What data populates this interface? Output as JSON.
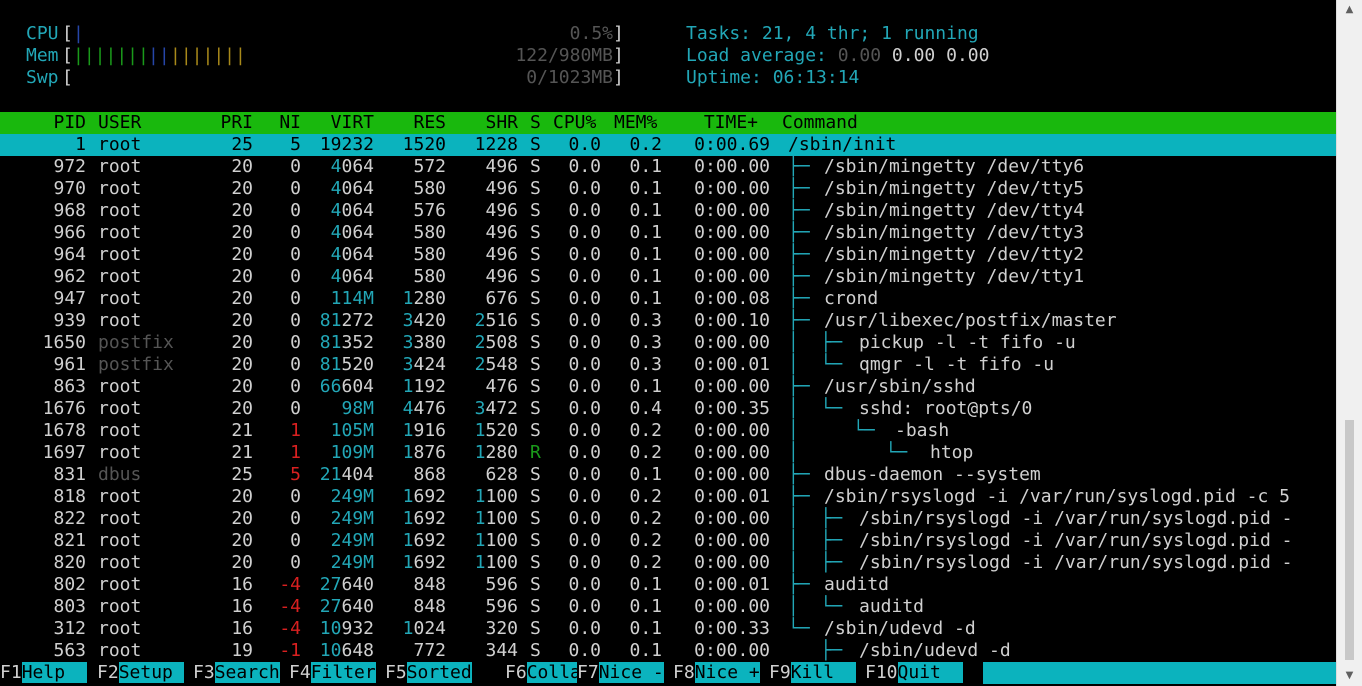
{
  "meters": {
    "cpu": {
      "label": "CPU",
      "bar": "|",
      "value": "0.5%"
    },
    "mem": {
      "label": "Mem",
      "bar_green": "|||||||",
      "bar_blue": "||",
      "bar_yellow": "|||||||",
      "value": "122/980MB"
    },
    "swp": {
      "label": "Swp",
      "value": "0/1023MB"
    }
  },
  "summary": {
    "tasks_label": "Tasks: ",
    "tasks_count": "21",
    "tasks_sep": ", ",
    "threads": "4",
    "threads_label": " thr; ",
    "running": "1",
    "running_label": " running",
    "load_label": "Load average: ",
    "load1": "0.00",
    "load5": "0.00",
    "load15": "0.00",
    "uptime_label": "Uptime: ",
    "uptime": "06:13:14"
  },
  "columns": {
    "pid": "PID",
    "user": "USER",
    "pri": "PRI",
    "ni": "NI",
    "virt": "VIRT",
    "res": "RES",
    "shr": "SHR",
    "s": "S",
    "cpu": "CPU%",
    "mem": "MEM%",
    "time": "TIME+",
    "cmd": "Command"
  },
  "processes": [
    {
      "pid": "1",
      "user": "root",
      "pri": "25",
      "ni": "5",
      "virt": "19232",
      "res": "1520",
      "shr": "1228",
      "s": "S",
      "cpu": "0.0",
      "mem": "0.2",
      "time": "0:00.69",
      "tree": "",
      "cmd": "/sbin/init"
    },
    {
      "pid": "972",
      "user": "root",
      "pri": "20",
      "ni": "0",
      "virt": "4064",
      "res": "572",
      "shr": "496",
      "s": "S",
      "cpu": "0.0",
      "mem": "0.1",
      "time": "0:00.00",
      "tree": "├─ ",
      "cmd": "/sbin/mingetty /dev/tty6"
    },
    {
      "pid": "970",
      "user": "root",
      "pri": "20",
      "ni": "0",
      "virt": "4064",
      "res": "580",
      "shr": "496",
      "s": "S",
      "cpu": "0.0",
      "mem": "0.1",
      "time": "0:00.00",
      "tree": "├─ ",
      "cmd": "/sbin/mingetty /dev/tty5"
    },
    {
      "pid": "968",
      "user": "root",
      "pri": "20",
      "ni": "0",
      "virt": "4064",
      "res": "576",
      "shr": "496",
      "s": "S",
      "cpu": "0.0",
      "mem": "0.1",
      "time": "0:00.00",
      "tree": "├─ ",
      "cmd": "/sbin/mingetty /dev/tty4"
    },
    {
      "pid": "966",
      "user": "root",
      "pri": "20",
      "ni": "0",
      "virt": "4064",
      "res": "580",
      "shr": "496",
      "s": "S",
      "cpu": "0.0",
      "mem": "0.1",
      "time": "0:00.00",
      "tree": "├─ ",
      "cmd": "/sbin/mingetty /dev/tty3"
    },
    {
      "pid": "964",
      "user": "root",
      "pri": "20",
      "ni": "0",
      "virt": "4064",
      "res": "580",
      "shr": "496",
      "s": "S",
      "cpu": "0.0",
      "mem": "0.1",
      "time": "0:00.00",
      "tree": "├─ ",
      "cmd": "/sbin/mingetty /dev/tty2"
    },
    {
      "pid": "962",
      "user": "root",
      "pri": "20",
      "ni": "0",
      "virt": "4064",
      "res": "580",
      "shr": "496",
      "s": "S",
      "cpu": "0.0",
      "mem": "0.1",
      "time": "0:00.00",
      "tree": "├─ ",
      "cmd": "/sbin/mingetty /dev/tty1"
    },
    {
      "pid": "947",
      "user": "root",
      "pri": "20",
      "ni": "0",
      "virt": "114M",
      "res": "1280",
      "shr": "676",
      "s": "S",
      "cpu": "0.0",
      "mem": "0.1",
      "time": "0:00.08",
      "tree": "├─ ",
      "cmd": "crond"
    },
    {
      "pid": "939",
      "user": "root",
      "pri": "20",
      "ni": "0",
      "virt": "81272",
      "res": "3420",
      "shr": "2516",
      "s": "S",
      "cpu": "0.0",
      "mem": "0.3",
      "time": "0:00.10",
      "tree": "├─ ",
      "cmd": "/usr/libexec/postfix/master"
    },
    {
      "pid": "1650",
      "user": "postfix",
      "pri": "20",
      "ni": "0",
      "virt": "81352",
      "res": "3380",
      "shr": "2508",
      "s": "S",
      "cpu": "0.0",
      "mem": "0.3",
      "time": "0:00.00",
      "tree": "│  ├─ ",
      "cmd": "pickup -l -t fifo -u"
    },
    {
      "pid": "961",
      "user": "postfix",
      "pri": "20",
      "ni": "0",
      "virt": "81520",
      "res": "3424",
      "shr": "2548",
      "s": "S",
      "cpu": "0.0",
      "mem": "0.3",
      "time": "0:00.01",
      "tree": "│  └─ ",
      "cmd": "qmgr -l -t fifo -u"
    },
    {
      "pid": "863",
      "user": "root",
      "pri": "20",
      "ni": "0",
      "virt": "66604",
      "res": "1192",
      "shr": "476",
      "s": "S",
      "cpu": "0.0",
      "mem": "0.1",
      "time": "0:00.00",
      "tree": "├─ ",
      "cmd": "/usr/sbin/sshd"
    },
    {
      "pid": "1676",
      "user": "root",
      "pri": "20",
      "ni": "0",
      "virt": "98M",
      "res": "4476",
      "shr": "3472",
      "s": "S",
      "cpu": "0.0",
      "mem": "0.4",
      "time": "0:00.35",
      "tree": "│  └─ ",
      "cmd": "sshd: root@pts/0"
    },
    {
      "pid": "1678",
      "user": "root",
      "pri": "21",
      "ni": "1",
      "virt": "105M",
      "res": "1916",
      "shr": "1520",
      "s": "S",
      "cpu": "0.0",
      "mem": "0.2",
      "time": "0:00.00",
      "tree": "│     └─ ",
      "cmd": "-bash"
    },
    {
      "pid": "1697",
      "user": "root",
      "pri": "21",
      "ni": "1",
      "virt": "109M",
      "res": "1876",
      "shr": "1280",
      "s": "R",
      "cpu": "0.0",
      "mem": "0.2",
      "time": "0:00.00",
      "tree": "│        └─ ",
      "cmd": "htop"
    },
    {
      "pid": "831",
      "user": "dbus",
      "pri": "25",
      "ni": "5",
      "virt": "21404",
      "res": "868",
      "shr": "628",
      "s": "S",
      "cpu": "0.0",
      "mem": "0.1",
      "time": "0:00.00",
      "tree": "├─ ",
      "cmd": "dbus-daemon --system"
    },
    {
      "pid": "818",
      "user": "root",
      "pri": "20",
      "ni": "0",
      "virt": "249M",
      "res": "1692",
      "shr": "1100",
      "s": "S",
      "cpu": "0.0",
      "mem": "0.2",
      "time": "0:00.01",
      "tree": "├─ ",
      "cmd": "/sbin/rsyslogd -i /var/run/syslogd.pid -c 5"
    },
    {
      "pid": "822",
      "user": "root",
      "pri": "20",
      "ni": "0",
      "virt": "249M",
      "res": "1692",
      "shr": "1100",
      "s": "S",
      "cpu": "0.0",
      "mem": "0.2",
      "time": "0:00.00",
      "tree": "│  ├─ ",
      "cmd": "/sbin/rsyslogd -i /var/run/syslogd.pid -"
    },
    {
      "pid": "821",
      "user": "root",
      "pri": "20",
      "ni": "0",
      "virt": "249M",
      "res": "1692",
      "shr": "1100",
      "s": "S",
      "cpu": "0.0",
      "mem": "0.2",
      "time": "0:00.00",
      "tree": "│  ├─ ",
      "cmd": "/sbin/rsyslogd -i /var/run/syslogd.pid -"
    },
    {
      "pid": "820",
      "user": "root",
      "pri": "20",
      "ni": "0",
      "virt": "249M",
      "res": "1692",
      "shr": "1100",
      "s": "S",
      "cpu": "0.0",
      "mem": "0.2",
      "time": "0:00.00",
      "tree": "│  ├─ ",
      "cmd": "/sbin/rsyslogd -i /var/run/syslogd.pid -"
    },
    {
      "pid": "802",
      "user": "root",
      "pri": "16",
      "ni": "-4",
      "virt": "27640",
      "res": "848",
      "shr": "596",
      "s": "S",
      "cpu": "0.0",
      "mem": "0.1",
      "time": "0:00.01",
      "tree": "├─ ",
      "cmd": "auditd"
    },
    {
      "pid": "803",
      "user": "root",
      "pri": "16",
      "ni": "-4",
      "virt": "27640",
      "res": "848",
      "shr": "596",
      "s": "S",
      "cpu": "0.0",
      "mem": "0.1",
      "time": "0:00.00",
      "tree": "│  └─ ",
      "cmd": "auditd"
    },
    {
      "pid": "312",
      "user": "root",
      "pri": "16",
      "ni": "-4",
      "virt": "10932",
      "res": "1024",
      "shr": "320",
      "s": "S",
      "cpu": "0.0",
      "mem": "0.1",
      "time": "0:00.33",
      "tree": "└─ ",
      "cmd": "/sbin/udevd -d"
    },
    {
      "pid": "563",
      "user": "root",
      "pri": "19",
      "ni": "-1",
      "virt": "10648",
      "res": "772",
      "shr": "344",
      "s": "S",
      "cpu": "0.0",
      "mem": "0.1",
      "time": "0:00.00",
      "tree": "   ├─ ",
      "cmd": "/sbin/udevd -d"
    }
  ],
  "footer": [
    {
      "key": "F1",
      "label": "Help  "
    },
    {
      "key": "F2",
      "label": "Setup "
    },
    {
      "key": "F3",
      "label": "Search"
    },
    {
      "key": "F4",
      "label": "Filter"
    },
    {
      "key": "F5",
      "label": "Sorted"
    },
    {
      "key": "F6",
      "label": "Collap"
    },
    {
      "key": "F7",
      "label": "Nice -"
    },
    {
      "key": "F8",
      "label": "Nice +"
    },
    {
      "key": "F9",
      "label": "Kill  "
    },
    {
      "key": "F10",
      "label": "Quit  "
    }
  ],
  "scrollbar": {
    "up_arrow": "▲",
    "down_arrow": "▼"
  }
}
